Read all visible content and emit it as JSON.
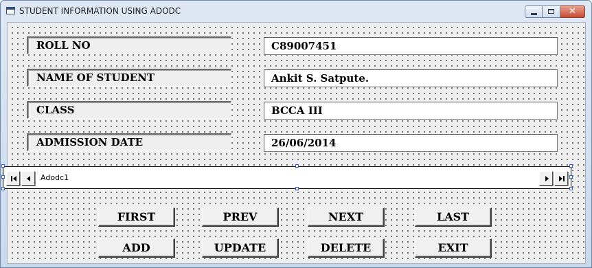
{
  "window": {
    "title": "STUDENT INFORMATION USING ADODC",
    "controls": {
      "minimize_icon": "minimize-icon",
      "maximize_icon": "maximize-icon",
      "close_icon": "close-icon"
    },
    "colors": {
      "close_button": "#c74a33",
      "form_background": "#efefef",
      "selection_handle": "#2d5fd1"
    }
  },
  "fields": {
    "roll_no": {
      "label": "ROLL NO",
      "value": "C89007451"
    },
    "name": {
      "label": "NAME OF STUDENT",
      "value": "Ankit S. Satpute."
    },
    "class": {
      "label": "CLASS",
      "value": "BCCA III"
    },
    "admission_date": {
      "label": "ADMISSION DATE",
      "value": "26/06/2014"
    }
  },
  "adodc": {
    "caption": "Adodc1",
    "icons": [
      "move-first-icon",
      "move-previous-icon",
      "move-next-icon",
      "move-last-icon"
    ]
  },
  "buttons": {
    "first": "FIRST",
    "prev": "PREV",
    "next": "NEXT",
    "last": "LAST",
    "add": "ADD",
    "update": "UPDATE",
    "delete": "DELETE",
    "exit": "EXIT"
  }
}
